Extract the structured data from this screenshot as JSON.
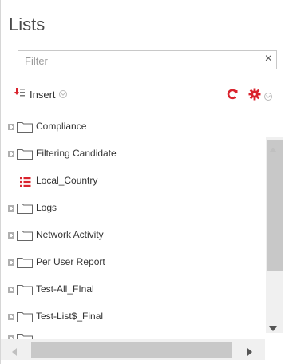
{
  "panel": {
    "title": "Lists"
  },
  "filter": {
    "placeholder": "Filter",
    "value": "",
    "clear_symbol": "×"
  },
  "toolbar": {
    "insert_label": "Insert",
    "insert_icon": "insert-list-icon",
    "refresh_icon": "refresh-icon",
    "settings_icon": "gear-icon"
  },
  "colors": {
    "accent_red": "#d9232d",
    "folder_outline": "#666666",
    "text": "#333333"
  },
  "tree": {
    "items": [
      {
        "label": "Compliance",
        "type": "folder",
        "icon": "folder-icon",
        "expandable": true
      },
      {
        "label": "Filtering Candidate",
        "type": "folder",
        "icon": "folder-icon",
        "expandable": true
      },
      {
        "label": "Local_Country",
        "type": "list",
        "icon": "list-icon",
        "expandable": false
      },
      {
        "label": "Logs",
        "type": "folder",
        "icon": "folder-icon",
        "expandable": true
      },
      {
        "label": "Network Activity",
        "type": "folder",
        "icon": "folder-icon",
        "expandable": true
      },
      {
        "label": "Per User Report",
        "type": "folder",
        "icon": "folder-icon",
        "expandable": true
      },
      {
        "label": "Test-All_FInal",
        "type": "folder",
        "icon": "folder-icon",
        "expandable": true
      },
      {
        "label": "Test-List$_Final",
        "type": "folder",
        "icon": "folder-icon",
        "expandable": true
      }
    ]
  }
}
